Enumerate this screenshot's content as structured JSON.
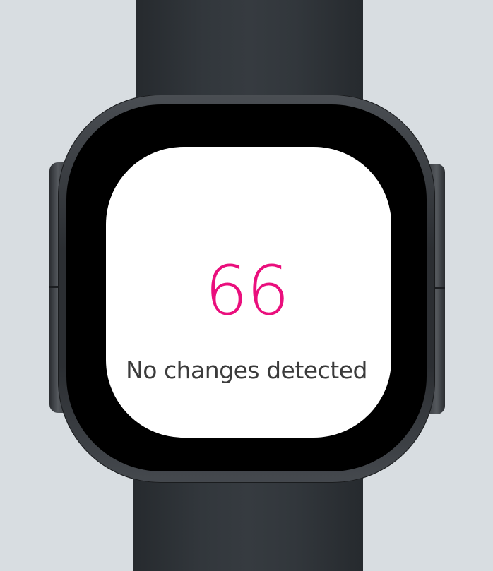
{
  "watch": {
    "reading_value": "66",
    "status_text": "No changes detected"
  },
  "colors": {
    "background": "#d8dde1",
    "band": "#32373c",
    "bezel": "#000000",
    "screen": "#ffffff",
    "reading_accent": "#ea0f7d",
    "status_text": "#3b3b3b"
  }
}
